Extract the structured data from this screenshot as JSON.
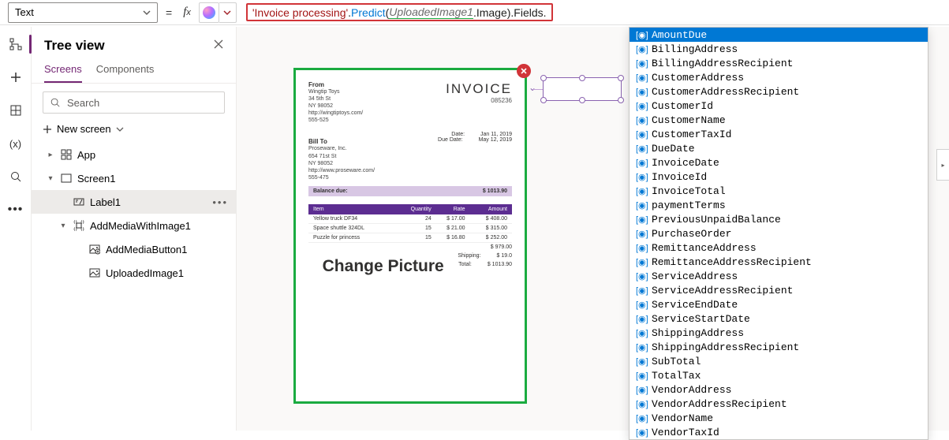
{
  "formulaBar": {
    "property": "Text",
    "formula_string": "'Invoice processing'",
    "formula_method": "Predict",
    "formula_ident": "UploadedImage1",
    "formula_member": ".Image).Fields.",
    "open_paren": "(",
    "dot": "."
  },
  "treeView": {
    "title": "Tree view",
    "tabs": [
      "Screens",
      "Components"
    ],
    "searchPlaceholder": "Search",
    "newScreen": "New screen",
    "items": [
      {
        "label": "App",
        "depth": 1,
        "icon": "app",
        "caret": "▸"
      },
      {
        "label": "Screen1",
        "depth": 1,
        "icon": "screen",
        "caret": "▾"
      },
      {
        "label": "Label1",
        "depth": 2,
        "icon": "label",
        "selected": true
      },
      {
        "label": "AddMediaWithImage1",
        "depth": 2,
        "icon": "group",
        "caret": "▾"
      },
      {
        "label": "AddMediaButton1",
        "depth": 3,
        "icon": "media"
      },
      {
        "label": "UploadedImage1",
        "depth": 3,
        "icon": "image"
      }
    ]
  },
  "canvas": {
    "invoice": {
      "fromTitle": "From",
      "fromLines": [
        "Wingtip Toys",
        "34 5th St",
        "NY 98052",
        "http://wingtiptoys.com/",
        "555-525"
      ],
      "title": "INVOICE",
      "number": "085236",
      "meta": [
        {
          "k": "Date:",
          "v": "Jan 11, 2019"
        },
        {
          "k": "Due Date:",
          "v": "May 12, 2019"
        }
      ],
      "billTitle": "Bill To",
      "billLines": [
        "Proseware, Inc.",
        "654 71st St",
        "NY 98052",
        "http://www.proseware.com/",
        "555-475"
      ],
      "balanceLabel": "Balance due:",
      "balanceValue": "$ 1013.90",
      "cols": [
        "Item",
        "Quantity",
        "Rate",
        "Amount"
      ],
      "rows": [
        {
          "c": [
            "Yellow truck DF34",
            "24",
            "$ 17.00",
            "$ 408.00"
          ]
        },
        {
          "c": [
            "Space shuttle 324DL",
            "15",
            "$ 21.00",
            "$ 315.00"
          ]
        },
        {
          "c": [
            "Puzzle for princess",
            "15",
            "$ 16.80",
            "$ 252.00"
          ]
        }
      ],
      "changePicture": "Change Picture",
      "totals": [
        {
          "k": "",
          "v": "$ 979.00"
        },
        {
          "k": "",
          "v": ""
        },
        {
          "k": "Shipping:",
          "v": "$ 19.0"
        },
        {
          "k": "Total:",
          "v": "$ 1013.90"
        }
      ]
    }
  },
  "intellisense": {
    "items": [
      "AmountDue",
      "BillingAddress",
      "BillingAddressRecipient",
      "CustomerAddress",
      "CustomerAddressRecipient",
      "CustomerId",
      "CustomerName",
      "CustomerTaxId",
      "DueDate",
      "InvoiceDate",
      "InvoiceId",
      "InvoiceTotal",
      "paymentTerms",
      "PreviousUnpaidBalance",
      "PurchaseOrder",
      "RemittanceAddress",
      "RemittanceAddressRecipient",
      "ServiceAddress",
      "ServiceAddressRecipient",
      "ServiceEndDate",
      "ServiceStartDate",
      "ShippingAddress",
      "ShippingAddressRecipient",
      "SubTotal",
      "TotalTax",
      "VendorAddress",
      "VendorAddressRecipient",
      "VendorName",
      "VendorTaxId"
    ],
    "selectedIndex": 0
  }
}
